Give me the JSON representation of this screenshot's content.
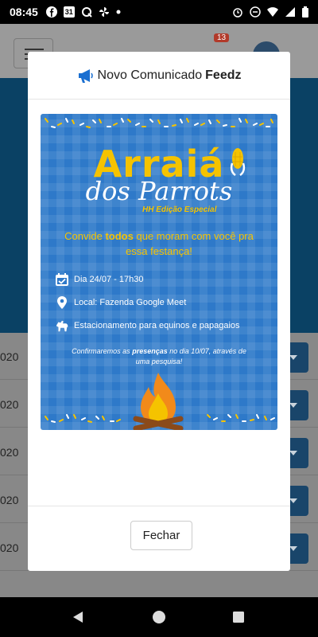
{
  "status_bar": {
    "time": "08:45",
    "calendar_day": "31",
    "notification_icons": [
      "facebook-icon",
      "calendar-icon",
      "q-icon",
      "pinwheel-icon",
      "dot-icon"
    ],
    "system_icons": [
      "alarm-icon",
      "dnd-icon",
      "wifi-icon",
      "signal-icon",
      "battery-icon"
    ]
  },
  "background_app": {
    "notification_count": "13",
    "list_rows": [
      {
        "text": "020"
      },
      {
        "text": "020"
      },
      {
        "text": "020"
      },
      {
        "text": "020"
      },
      {
        "text": "020"
      }
    ]
  },
  "modal": {
    "title_prefix": "Novo Comunicado",
    "title_brand": "Feedz",
    "close_label": "Fechar"
  },
  "flyer": {
    "title_line1": "Arraiá",
    "title_line2": "dos Parrots",
    "subtitle": "HH Edição Especial",
    "invite_before": "Convide",
    "invite_bold": "todos",
    "invite_after": "que moram com você pra essa festança!",
    "date_text": "Dia 24/07 - 17h30",
    "location_text": "Local: Fazenda Google Meet",
    "parking_text": "Estacionamento para equinos e papagaios",
    "confirm_before": "Confirmaremos as",
    "confirm_bold": "presenças",
    "confirm_after": "no dia 10/07, através de uma pesquisa!"
  },
  "colors": {
    "flyer_blue": "#2e79c9",
    "flyer_yellow": "#f5c300",
    "band_blue": "#0a4164"
  },
  "nav_bar": {
    "buttons": [
      "back-icon",
      "home-icon",
      "recents-icon"
    ]
  }
}
